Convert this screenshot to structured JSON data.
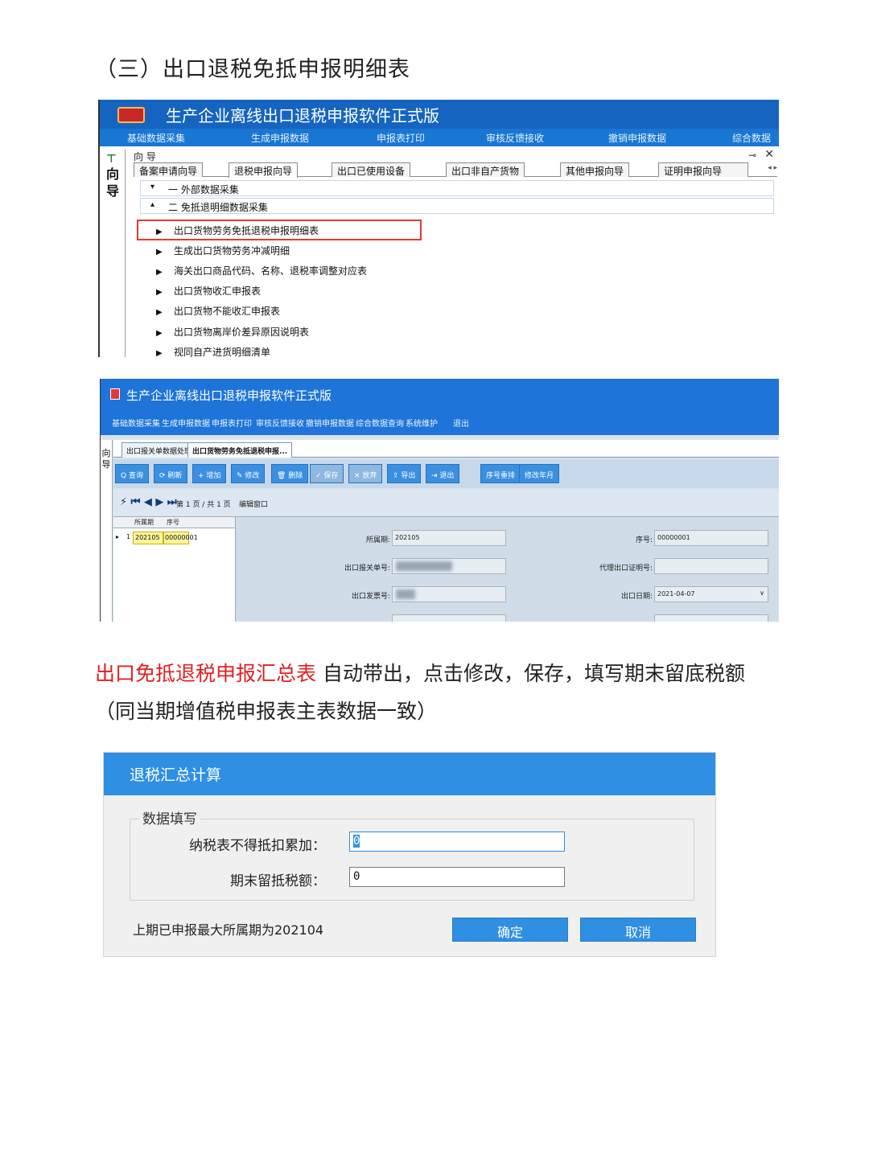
{
  "heading": "（三）出口退税免抵申报明细表",
  "shot1": {
    "app_title": "生产企业离线出口退税申报软件正式版",
    "menu": [
      "基础数据采集",
      "生成申报数据",
      "申报表打印",
      "审核反馈接收",
      "撤销申报数据",
      "综合数据"
    ],
    "side_label": "向导",
    "nav_head": "向 导",
    "pin_icon": "pin-icon",
    "close_symbol": "✕",
    "tabs": [
      "备案申请向导",
      "退税申报向导",
      "出口已使用设备",
      "出口非自产货物",
      "其他申报向导",
      "证明申报向导"
    ],
    "tab_arrows": "◂  ▸",
    "groups": [
      {
        "arrow": "▾",
        "label": "一  外部数据采集"
      },
      {
        "arrow": "▴",
        "label": "二  免抵退明细数据采集"
      }
    ],
    "items": [
      "出口货物劳务免抵退税申报明细表",
      "生成出口货物劳务冲减明细",
      "海关出口商品代码、名称、退税率调整对应表",
      "出口货物收汇申报表",
      "出口货物不能收汇申报表",
      "出口货物离岸价差异原因说明表",
      "视同自产进货明细清单"
    ]
  },
  "shot2": {
    "app_title": "生产企业离线出口退税申报软件正式版",
    "menu": [
      "基础数据采集",
      "生成申报数据",
      "申报表打印",
      "审核反馈接收",
      "撤销申报数据",
      "综合数据查询",
      "系统维护",
      "退出"
    ],
    "side_label": "向导",
    "tabs": [
      "出口报关单数据处理",
      "出口货物劳务免抵退税申报..."
    ],
    "toolbar": [
      "Q 查询",
      "⟳ 刷新",
      "+ 增加",
      "✎ 修改",
      "🗑 删除",
      "✓ 保存",
      "✕ 放弃",
      "⇪ 导出",
      "⇥ 退出",
      "序号重排",
      "修改年月"
    ],
    "pager_icons": "⚡ ⏮ ◀ ▶ ⏭",
    "pager_text": "第 1 页 / 共 1 页",
    "edit_window": "编辑窗口",
    "grid_headers": [
      "所属期",
      "序号"
    ],
    "grid_row": {
      "marker": "▸",
      "index": "1",
      "period": "202105",
      "seq": "00000001"
    },
    "fields": {
      "period_label": "所属期:",
      "period_value": "202105",
      "seq_label": "序号:",
      "seq_value": "00000001",
      "customs_label": "出口报关单号:",
      "agent_label": "代理出口证明号:",
      "invoice_label": "出口发票号:",
      "date_label": "出口日期:",
      "date_value": "2021-04-07"
    }
  },
  "paragraph": {
    "red": "出口免抵退税申报汇总表",
    "rest": " 自动带出，点击修改，保存，填写期末留底税额（同当期增值税申报表主表数据一致）"
  },
  "dialog": {
    "title": "退税汇总计算",
    "group_label": "数据填写",
    "field1_label": "纳税表不得抵扣累加：",
    "field1_value": "0",
    "field2_label": "期末留抵税额：",
    "field2_value": "0",
    "info": "上期已申报最大所属期为202104",
    "ok": "确定",
    "cancel": "取消"
  },
  "colors": {
    "accent_blue": "#1e74d8",
    "highlight_red": "#e53935",
    "paragraph_red": "#e02020"
  }
}
